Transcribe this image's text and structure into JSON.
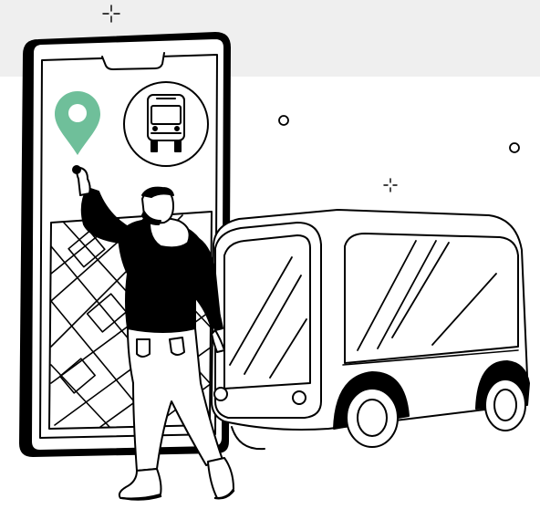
{
  "illustration": {
    "subject": "person-tapping-map-pin-next-to-phone-and-autonomous-shuttle",
    "colors": {
      "background": "#ffffff",
      "top_band": "#efefef",
      "ink": "#000000",
      "pin_accent": "#6fbf9a"
    },
    "icons": [
      "location-pin-icon",
      "bus-icon",
      "sparkle-icon"
    ]
  }
}
